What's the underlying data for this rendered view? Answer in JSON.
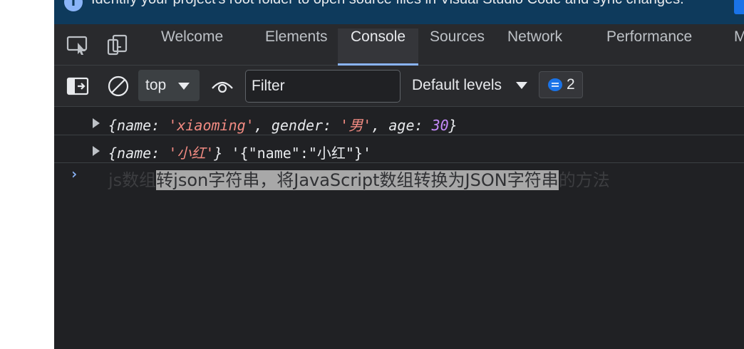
{
  "banner": {
    "icon": "info-icon",
    "text": "Identify your project's root folder to open source files in Visual Studio Code and sync changes."
  },
  "tabs": {
    "inspect_icon": "inspect-element-icon",
    "device_icon": "device-emulation-icon",
    "items": [
      {
        "label": "Welcome",
        "active": false
      },
      {
        "label": "Elements",
        "active": false
      },
      {
        "label": "Console",
        "active": true
      },
      {
        "label": "Sources",
        "active": false
      },
      {
        "label": "Network",
        "active": false
      },
      {
        "label": "Performance",
        "active": false
      },
      {
        "label": "M",
        "active": false
      }
    ]
  },
  "toolbar": {
    "sidebar_icon": "toggle-sidebar-icon",
    "clear_icon": "clear-console-icon",
    "context": "top",
    "eye_icon": "live-expression-eye-icon",
    "filter_placeholder": "Filter",
    "levels": "Default levels",
    "issues_count": "2"
  },
  "console": {
    "rows": [
      {
        "parts": [
          {
            "t": "{",
            "c": "p"
          },
          {
            "t": "name",
            "c": "k"
          },
          {
            "t": ": ",
            "c": "p"
          },
          {
            "t": "'xiaoming'",
            "c": "s"
          },
          {
            "t": ", ",
            "c": "p"
          },
          {
            "t": "gender",
            "c": "k"
          },
          {
            "t": ": ",
            "c": "p"
          },
          {
            "t": "'男'",
            "c": "s"
          },
          {
            "t": ", ",
            "c": "p"
          },
          {
            "t": "age",
            "c": "k"
          },
          {
            "t": ": ",
            "c": "p"
          },
          {
            "t": "30",
            "c": "n"
          },
          {
            "t": "}",
            "c": "p"
          }
        ]
      },
      {
        "parts": [
          {
            "t": "{",
            "c": "p"
          },
          {
            "t": "name",
            "c": "k"
          },
          {
            "t": ": ",
            "c": "p"
          },
          {
            "t": "'小红'",
            "c": "s"
          },
          {
            "t": "} ",
            "c": "p"
          },
          {
            "t": "'{\"name\":\"小红\"}'",
            "c": "plain"
          }
        ]
      }
    ],
    "prompt": "›"
  },
  "caption": {
    "pre": "js数组",
    "highlight": "转json字符串，将JavaScript数组转换为JSON字符串",
    "post": "的方法"
  },
  "colors": {
    "panel_bg": "#202124",
    "toolbar_bg": "#292a2d",
    "accent": "#8ab4f8",
    "string": "#f28b82",
    "number": "#c58af9"
  }
}
